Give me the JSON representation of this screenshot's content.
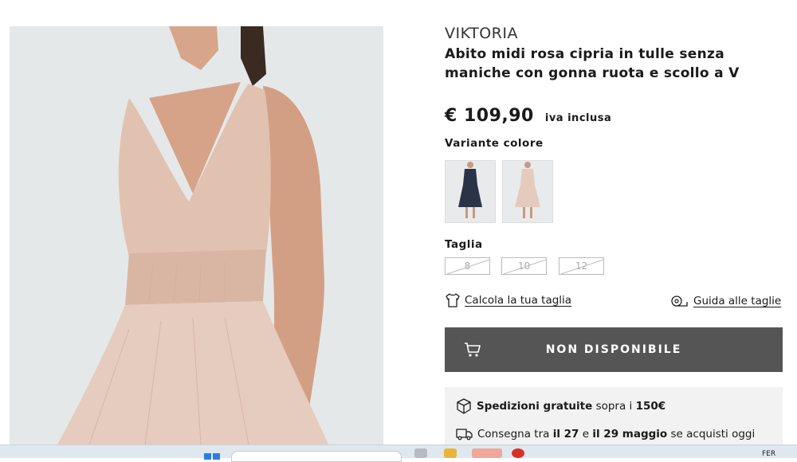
{
  "product": {
    "brand": "VIKTORIA",
    "title": "Abito midi rosa cipria in tulle senza maniche con gonna ruota e scollo a V",
    "price": "€ 109,90",
    "vat_note": "iva inclusa"
  },
  "variants": {
    "label": "Variante colore",
    "items": [
      {
        "name": "navy",
        "color": "#2a3446"
      },
      {
        "name": "rosa cipria",
        "color": "#e4cbbd"
      }
    ]
  },
  "sizes": {
    "label": "Taglia",
    "items": [
      "8",
      "10",
      "12"
    ]
  },
  "links": {
    "calc_size": "Calcola la tua taglia",
    "size_guide": "Guida alle taglie"
  },
  "cart": {
    "label": "NON DISPONIBILE"
  },
  "shipping": {
    "line1_bold": "Spedizioni gratuite",
    "line1_mid": "sopra i",
    "line1_amount": "150€",
    "line2_pre": "Consegna tra",
    "line2_date1": "il 27",
    "line2_and": "e",
    "line2_date2": "il 29 maggio",
    "line2_post": "se acquisti oggi"
  },
  "taskbar": {
    "tray_text": "FER"
  },
  "colors": {
    "dress": "#e3c6b7",
    "skin": "#d9a88c",
    "cart_bg": "#555555",
    "ship_bg": "#f2f2f2"
  }
}
